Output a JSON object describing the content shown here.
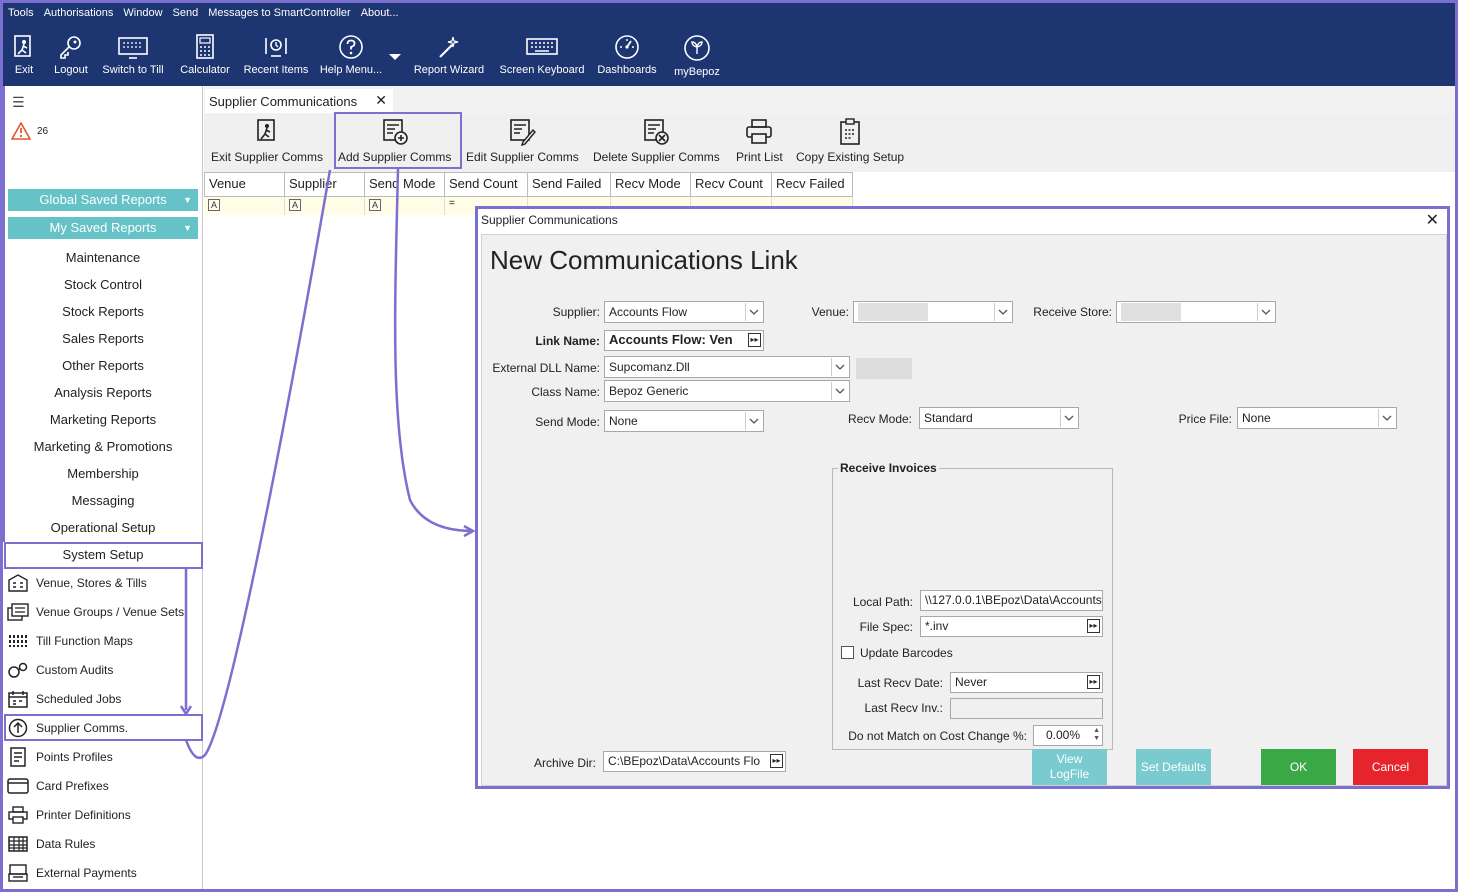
{
  "menu": [
    "Tools",
    "Authorisations",
    "Window",
    "Send",
    "Messages to SmartController",
    "About..."
  ],
  "toolbar": {
    "exit": "Exit",
    "logout": "Logout",
    "switch_till": "Switch to Till",
    "calculator": "Calculator",
    "recent": "Recent Items",
    "help": "Help Menu...",
    "report_wizard": "Report Wizard",
    "screen_keyboard": "Screen Keyboard",
    "dashboards": "Dashboards",
    "mybepoz": "myBepoz"
  },
  "sidebar": {
    "alert_count": "26",
    "global_saved": "Global Saved Reports",
    "my_saved": "My Saved Reports",
    "items": [
      "Maintenance",
      "Stock Control",
      "Stock Reports",
      "Sales Reports",
      "Other Reports",
      "Analysis Reports",
      "Marketing Reports",
      "Marketing & Promotions",
      "Membership",
      "Messaging",
      "Operational Setup",
      "System Setup"
    ],
    "sub_items": [
      "Venue, Stores & Tills",
      "Venue Groups / Venue Sets",
      "Till Function Maps",
      "Custom Audits",
      "Scheduled Jobs",
      "Supplier Comms.",
      "Points Profiles",
      "Card Prefixes",
      "Printer Definitions",
      "Data Rules",
      "External Payments"
    ]
  },
  "tab": {
    "label": "Supplier Communications"
  },
  "ribbon": {
    "exit": "Exit Supplier Comms",
    "add": "Add Supplier Comms",
    "edit": "Edit Supplier Comms",
    "delete": "Delete Supplier Comms",
    "print": "Print List",
    "copy": "Copy Existing Setup"
  },
  "grid": {
    "columns": [
      "Venue",
      "Supplier",
      "Send Mode",
      "Send Count",
      "Send Failed",
      "Recv Mode",
      "Recv Count",
      "Recv Failed"
    ]
  },
  "dialog": {
    "title": "Supplier Communications",
    "heading": "New Communications Link",
    "supplier_label": "Supplier:",
    "supplier_value": "Accounts Flow",
    "venue_label": "Venue:",
    "receive_store_label": "Receive Store:",
    "link_name_label": "Link Name:",
    "link_name_value": "Accounts Flow: Ven",
    "dll_label": "External DLL Name:",
    "dll_value": "Supcomanz.Dll",
    "class_label": "Class Name:",
    "class_value": "Bepoz Generic",
    "send_mode_label": "Send Mode:",
    "send_mode_value": "None",
    "recv_mode_label": "Recv Mode:",
    "recv_mode_value": "Standard",
    "price_file_label": "Price File:",
    "price_file_value": "None",
    "receive_invoices_title": "Receive Invoices",
    "local_path_label": "Local Path:",
    "local_path_value": "\\\\127.0.0.1\\BEpoz\\Data\\Accounts",
    "file_spec_label": "File Spec:",
    "file_spec_value": "*.inv",
    "update_barcodes_label": "Update Barcodes",
    "last_recv_date_label": "Last Recv Date:",
    "last_recv_date_value": "Never",
    "last_recv_inv_label": "Last Recv Inv.:",
    "cost_change_label": "Do not Match on Cost Change %:",
    "cost_change_value": "0.00%",
    "archive_label": "Archive Dir:",
    "archive_value": "C:\\BEpoz\\Data\\Accounts Flo",
    "view_log": "View LogFile",
    "set_defaults": "Set Defaults",
    "ok": "OK",
    "cancel": "Cancel"
  },
  "colors": {
    "topbar": "#1d3570",
    "saved_btn": "#65c3c7",
    "highlight": "#7b6fd0",
    "ok": "#3aa845",
    "cancel": "#e5242b",
    "disabled_btn": "#79cbd0"
  }
}
